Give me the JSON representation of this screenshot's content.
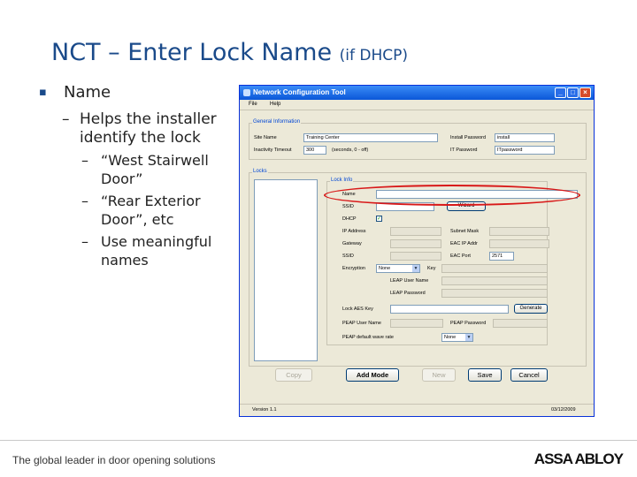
{
  "slide": {
    "title": "NCT – Enter Lock Name",
    "title_sub": "(if DHCP)",
    "bullet_marker": "▪",
    "dash_marker": "–",
    "bullets": {
      "b1": "Name",
      "b2": "Helps  the installer identify the lock",
      "b3a": "“West Stairwell Door”",
      "b3b": "“Rear Exterior Door”, etc",
      "b3c": "Use meaningful names"
    },
    "footer_tagline": "The global leader in door opening solutions",
    "logo_text": "ASSA ABLOY"
  },
  "window": {
    "title": "Network Configuration Tool",
    "buttons": {
      "minimize": "_",
      "maximize": "□",
      "close": "×"
    },
    "menu": {
      "file": "File",
      "help": "Help"
    },
    "general": {
      "legend": "General Information",
      "site_name_label": "Site Name",
      "site_name_value": "Training Center",
      "inactivity_label": "Inactivity Timeout",
      "inactivity_value": "300",
      "inactivity_hint": "(seconds, 0 - off)",
      "install_pw_label": "Install Password",
      "install_pw_value": "install",
      "it_pw_label": "IT Password",
      "it_pw_value": "ITpassword"
    },
    "locks": {
      "legend": "Locks"
    },
    "lockinfo": {
      "legend": "Lock Info",
      "name_label": "Name",
      "ssid_label": "SSID",
      "wizard_btn": "Wizard",
      "dhcp_label": "DHCP",
      "dhcp_check": "✓",
      "ip_label": "IP Address",
      "subnet_label": "Subnet Mask",
      "gateway_label": "Gateway",
      "eac_ip_label": "EAC IP Addr",
      "ssid2_label": "SSID",
      "eac_port_label": "EAC Port",
      "eac_port_value": "2571",
      "enc_label": "Encryption",
      "enc_value": "None",
      "key_label": "Key",
      "leap_user_label": "LEAP User Name",
      "leap_pw_label": "LEAP Password",
      "aes_label": "Lock AES Key",
      "generate_btn": "Generate",
      "peap_user_label": "PEAP User Name",
      "peap_pw_label": "PEAP Password",
      "peap_default_label": "PEAP default wave rate",
      "peap_default_value": "None"
    },
    "actions": {
      "copy": "Copy",
      "add_mode": "Add Mode",
      "new": "New",
      "save": "Save",
      "cancel": "Cancel"
    },
    "status": {
      "version": "Version 1.1",
      "date": "03/12/2009"
    }
  }
}
